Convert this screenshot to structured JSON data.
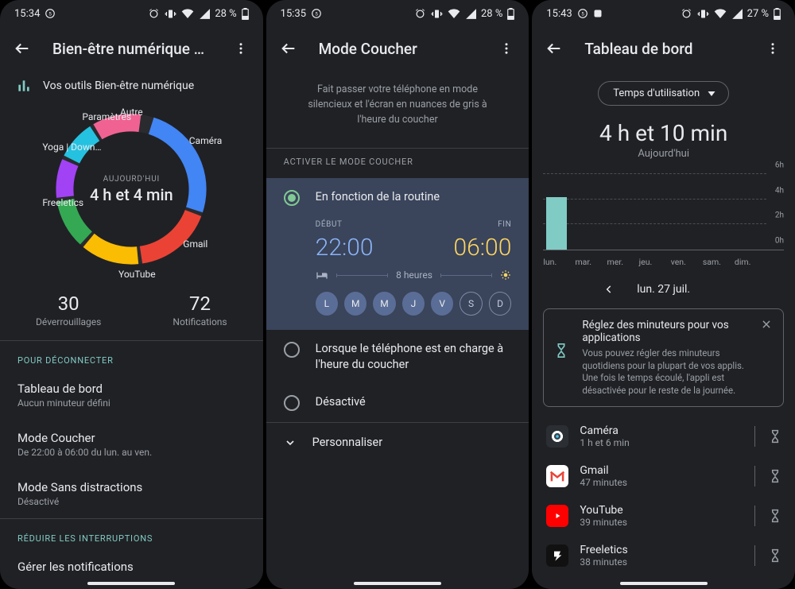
{
  "status": {
    "time1": "15:34",
    "time2": "15:35",
    "time3": "15:43",
    "battery1": "28 %",
    "battery2": "28 %",
    "battery3": "27 %"
  },
  "panel1": {
    "title": "Bien-être numérique et contrôl…",
    "tools": "Vos outils Bien-être numérique",
    "today_label": "AUJOURD'HUI",
    "today_value": "4 h et 4 min",
    "segments": {
      "autre": "Autre",
      "parametres": "Paramètres",
      "yoga": "Yoga | Down…",
      "freeletics": "Freeletics",
      "youtube": "YouTube",
      "gmail": "Gmail",
      "camera": "Caméra"
    },
    "unlocks_num": "30",
    "unlocks_cap": "Déverrouillages",
    "notif_num": "72",
    "notif_cap": "Notifications",
    "section_disconnect": "POUR DÉCONNECTER",
    "dashboard": {
      "t": "Tableau de bord",
      "s": "Aucun minuteur défini"
    },
    "bedtime": {
      "t": "Mode Coucher",
      "s": "De 22:00 à 06:00 du lun. au ven."
    },
    "focus": {
      "t": "Mode Sans distractions",
      "s": "Désactivé"
    },
    "section_reduce": "RÉDUIRE LES INTERRUPTIONS",
    "manage_notif": "Gérer les notifications"
  },
  "panel2": {
    "title": "Mode Coucher",
    "desc": "Fait passer votre téléphone en mode silencieux et l'écran en nuances de gris à l'heure du coucher",
    "activate_cap": "ACTIVER LE MODE COUCHER",
    "opt1": "En fonction de la routine",
    "start_lab": "DÉBUT",
    "start_time": "22:00",
    "end_lab": "FIN",
    "end_time": "06:00",
    "duration": "8 heures",
    "days": [
      "L",
      "M",
      "M",
      "J",
      "V",
      "S",
      "D"
    ],
    "opt2": "Lorsque le téléphone est en charge à l'heure du coucher",
    "opt3": "Désactivé",
    "customize": "Personnaliser"
  },
  "panel3": {
    "title": "Tableau de bord",
    "chip": "Temps d'utilisation",
    "total": "4 h et 10 min",
    "today": "Aujourd'hui",
    "date": "lun. 27 juil.",
    "tip_h": "Réglez des minuteurs pour vos applications",
    "tip_p": "Vous pouvez régler des minuteurs quotidiens pour la plupart de vos applis. Une fois le temps écoulé, l'appli est désactivée pour le reste de la journée.",
    "apps": [
      {
        "name": "Caméra",
        "dur": "1 h et 6 min"
      },
      {
        "name": "Gmail",
        "dur": "47 minutes"
      },
      {
        "name": "YouTube",
        "dur": "39 minutes"
      },
      {
        "name": "Freeletics",
        "dur": "38 minutes"
      }
    ]
  },
  "chart_data": {
    "type": "bar",
    "categories": [
      "lun.",
      "mar.",
      "mer.",
      "jeu.",
      "ven.",
      "sam.",
      "dim."
    ],
    "values": [
      4.17,
      0,
      0,
      0,
      0,
      0,
      0
    ],
    "y_ticks": [
      "0h",
      "2h",
      "4h",
      "6h"
    ],
    "ylim": [
      0,
      6
    ],
    "ylabel": "",
    "title": ""
  }
}
